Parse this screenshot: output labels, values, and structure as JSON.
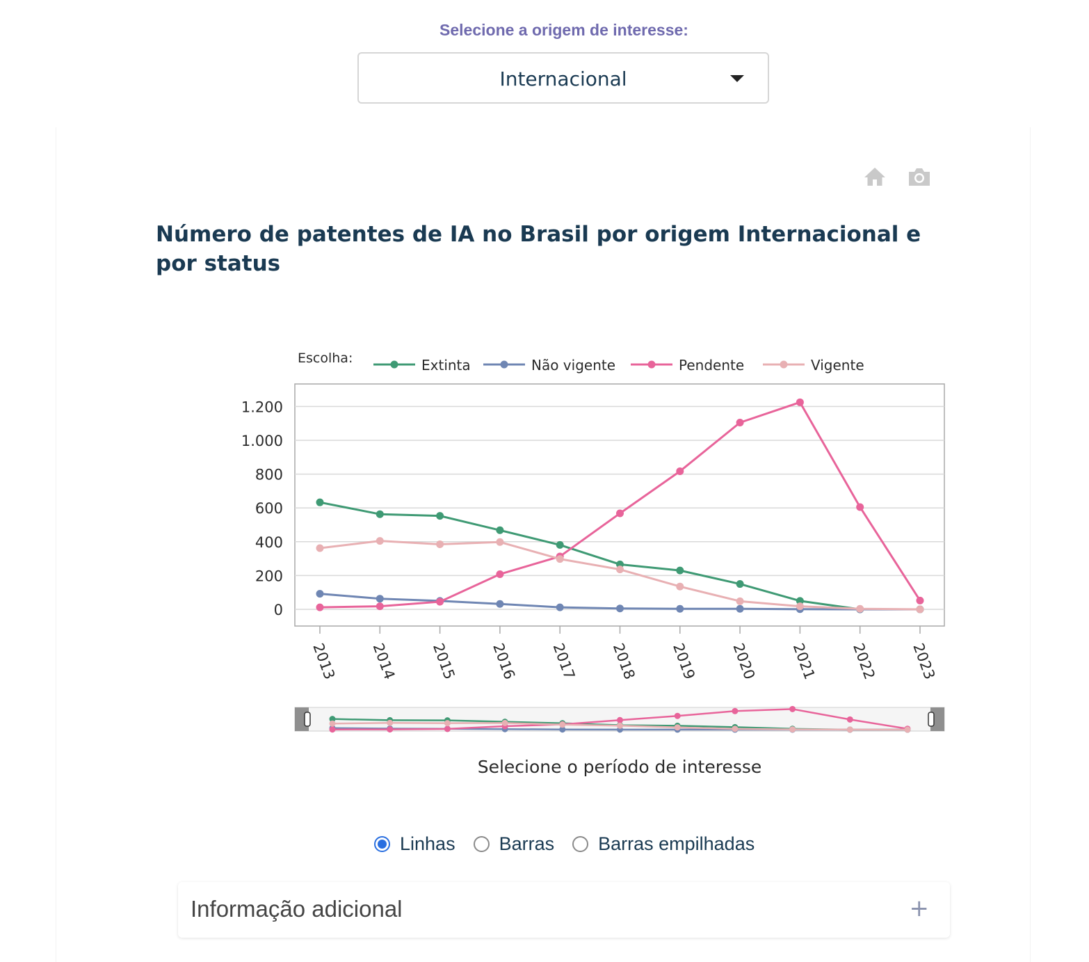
{
  "filter": {
    "label": "Selecione a origem de interesse:",
    "selected": "Internacional"
  },
  "toolbar": {
    "icons": [
      "home-icon",
      "camera-icon"
    ]
  },
  "chart_data": {
    "type": "line",
    "title": "Número de patentes de IA no Brasil por origem Internacional e por status",
    "legend_title": "Escolha:",
    "legend_position": "top",
    "x": [
      "2013",
      "2014",
      "2015",
      "2016",
      "2017",
      "2018",
      "2019",
      "2020",
      "2021",
      "2022",
      "2023"
    ],
    "yticks": [
      "0",
      "200",
      "400",
      "600",
      "800",
      "1.000",
      "1.200"
    ],
    "ylim": [
      -100,
      1330
    ],
    "grid": true,
    "series": [
      {
        "name": "Extinta",
        "color": "#3f9a74",
        "values": [
          633,
          563,
          553,
          468,
          381,
          266,
          230,
          150,
          50,
          0,
          0
        ]
      },
      {
        "name": "Não vigente",
        "color": "#6f86b3",
        "values": [
          92,
          63,
          50,
          32,
          12,
          5,
          3,
          3,
          1,
          0,
          0
        ]
      },
      {
        "name": "Pendente",
        "color": "#e8649a",
        "values": [
          12,
          18,
          45,
          208,
          313,
          568,
          817,
          1105,
          1225,
          605,
          52
        ]
      },
      {
        "name": "Vigente",
        "color": "#e8b0b3",
        "values": [
          362,
          405,
          385,
          398,
          298,
          236,
          135,
          48,
          18,
          3,
          0
        ]
      }
    ],
    "range_slider_caption": "Selecione o período de interesse"
  },
  "chart_options": {
    "radios": [
      {
        "label": "Linhas",
        "checked": true
      },
      {
        "label": "Barras",
        "checked": false
      },
      {
        "label": "Barras empilhadas",
        "checked": false
      }
    ]
  },
  "accordion": {
    "title": "Informação adicional",
    "toggle": "+"
  }
}
